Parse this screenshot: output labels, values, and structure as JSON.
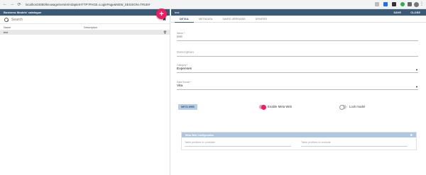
{
  "browser": {
    "url": "localhost:8080/knowage/servlet/AdapterHTTP?PAGE=LoginPage&NEW_SESSION=TRUE#"
  },
  "left_panel": {
    "title": "Business Models' catalogue",
    "search_placeholder": "Search",
    "add_label": "+",
    "columns": [
      "Name",
      "Description"
    ],
    "rows": [
      {
        "name": "test",
        "description": ""
      }
    ]
  },
  "right_panel": {
    "title": "test",
    "save_label": "SAVE",
    "close_label": "CLOSE",
    "tabs": [
      "DETAIL",
      "METADATA",
      "SAVED VERSIONS",
      "DRIVERS"
    ],
    "form": {
      "name_label": "Name *",
      "name_value": "test",
      "description_placeholder": "Description",
      "category_label": "Category *",
      "category_value": "Expenses",
      "datasource_label": "Data Source *",
      "datasource_value": "Vita"
    },
    "meta_web_button": "META WEB",
    "enable_meta_web": {
      "label": "Enable Meta Web",
      "on": true
    },
    "lock_model": {
      "label": "Lock model",
      "on": false
    },
    "config": {
      "title": "Meta Web Configuration",
      "include_placeholder": "Table prefixes to consider",
      "exclude_placeholder": "Table prefixes to exclude"
    }
  },
  "colors": {
    "header": "#3b5a78",
    "accent": "#e91e63",
    "button_bg": "#b8cde6"
  }
}
